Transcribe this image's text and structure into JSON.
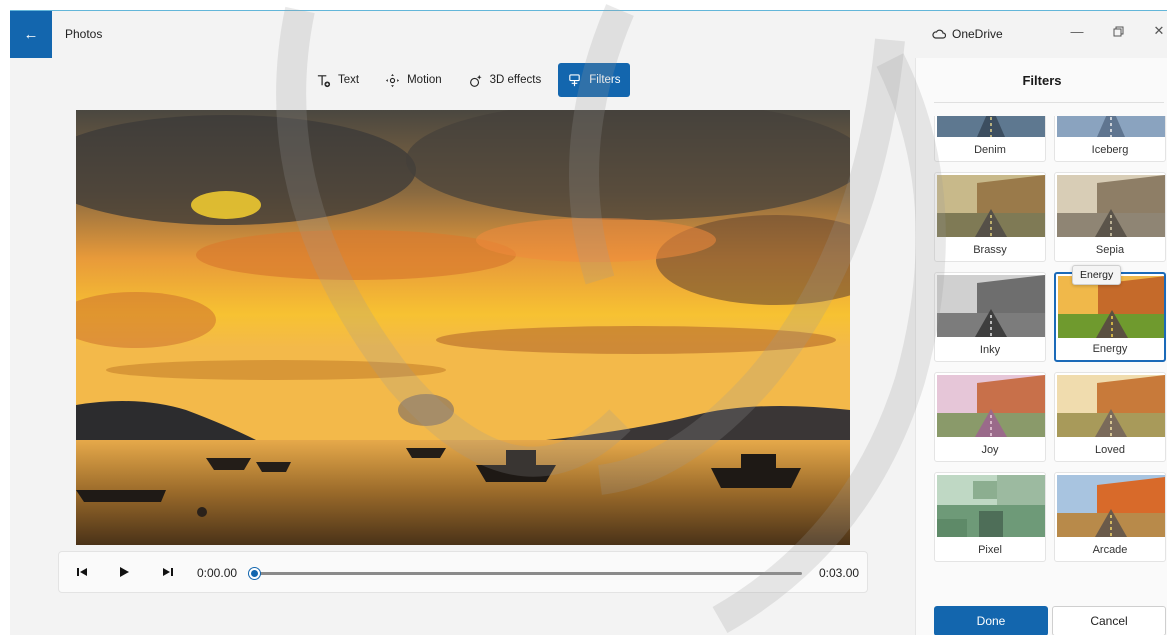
{
  "window": {
    "app_title": "Photos",
    "onedrive_label": "OneDrive"
  },
  "toolbar": {
    "items": [
      {
        "label": "Text",
        "icon": "text-icon"
      },
      {
        "label": "Motion",
        "icon": "motion-icon"
      },
      {
        "label": "3D effects",
        "icon": "3d-effects-icon"
      },
      {
        "label": "Filters",
        "icon": "filters-icon",
        "active": true
      }
    ]
  },
  "playback": {
    "current_time": "0:00.00",
    "total_time": "0:03.00",
    "progress": 0.0
  },
  "panel": {
    "title": "Filters",
    "filters": [
      {
        "label": "Denim"
      },
      {
        "label": "Iceberg"
      },
      {
        "label": "Brassy"
      },
      {
        "label": "Sepia"
      },
      {
        "label": "Inky"
      },
      {
        "label": "Energy",
        "selected": true
      },
      {
        "label": "Joy"
      },
      {
        "label": "Loved"
      },
      {
        "label": "Pixel"
      },
      {
        "label": "Arcade"
      }
    ],
    "tooltip": "Energy",
    "done_label": "Done",
    "cancel_label": "Cancel"
  },
  "colors": {
    "accent": "#1366ae",
    "selected_border": "#1b6ab8"
  }
}
